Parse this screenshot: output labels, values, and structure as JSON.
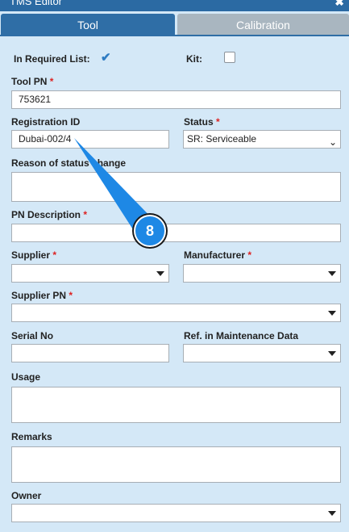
{
  "window": {
    "title": "TMS Editor",
    "close_glyph": "✖"
  },
  "tabs": [
    {
      "label": "Tool",
      "active": true
    },
    {
      "label": "Calibration",
      "active": false
    }
  ],
  "form": {
    "in_required_list": {
      "label": "In Required List:",
      "checked": true
    },
    "kit": {
      "label": "Kit:",
      "checked": false
    },
    "tool_pn": {
      "label": "Tool PN",
      "required": "*",
      "value": "753621"
    },
    "registration_id": {
      "label": "Registration ID",
      "value": "Dubai-002/4"
    },
    "status": {
      "label": "Status",
      "required": "*",
      "value": "SR: Serviceable"
    },
    "reason": {
      "label": "Reason of status change",
      "value": ""
    },
    "pn_description": {
      "label": "PN Description",
      "required": "*",
      "value": ""
    },
    "supplier": {
      "label": "Supplier",
      "required": "*",
      "value": ""
    },
    "manufacturer": {
      "label": "Manufacturer",
      "required": "*",
      "value": ""
    },
    "supplier_pn": {
      "label": "Supplier PN",
      "required": "*",
      "value": ""
    },
    "serial_no": {
      "label": "Serial No",
      "value": ""
    },
    "ref_maintenance": {
      "label": "Ref. in Maintenance Data",
      "value": ""
    },
    "usage": {
      "label": "Usage",
      "value": ""
    },
    "remarks": {
      "label": "Remarks",
      "value": ""
    },
    "owner": {
      "label": "Owner",
      "value": ""
    }
  },
  "callout": {
    "number": "8",
    "color": "#1e88e5"
  }
}
